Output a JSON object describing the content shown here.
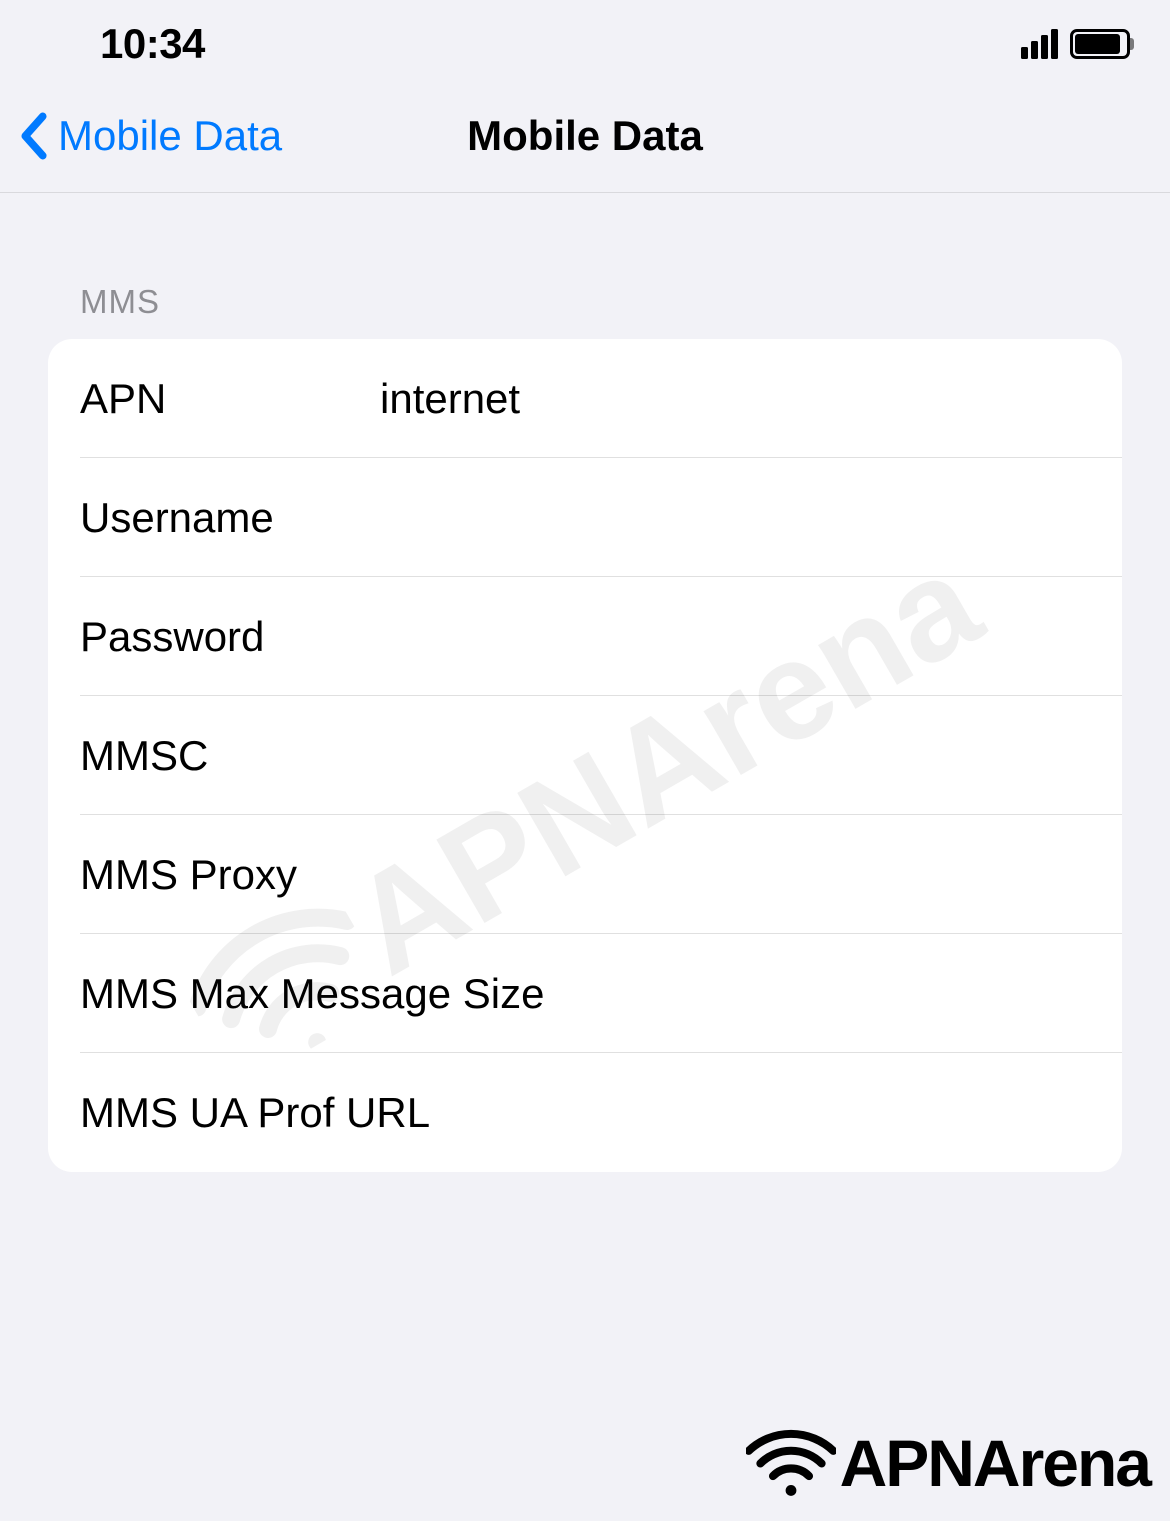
{
  "status_bar": {
    "time": "10:34"
  },
  "nav": {
    "back_label": "Mobile Data",
    "title": "Mobile Data"
  },
  "section": {
    "header": "MMS"
  },
  "fields": {
    "apn": {
      "label": "APN",
      "value": "internet"
    },
    "username": {
      "label": "Username",
      "value": ""
    },
    "password": {
      "label": "Password",
      "value": ""
    },
    "mmsc": {
      "label": "MMSC",
      "value": ""
    },
    "mms_proxy": {
      "label": "MMS Proxy",
      "value": ""
    },
    "mms_max_size": {
      "label": "MMS Max Message Size",
      "value": ""
    },
    "mms_ua_prof": {
      "label": "MMS UA Prof URL",
      "value": ""
    }
  },
  "watermark": {
    "text": "APNArena"
  }
}
